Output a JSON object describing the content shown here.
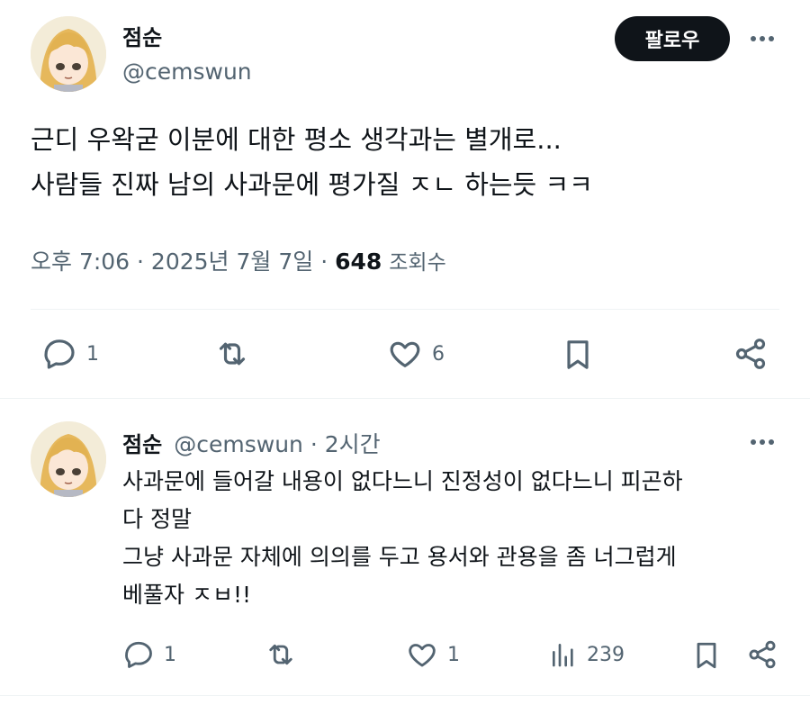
{
  "main_tweet": {
    "author_name": "점순",
    "author_handle": "@cemswun",
    "follow_label": "팔로우",
    "text_line1": "근디 우왁굳 이분에 대한 평소 생각과는 별개로...",
    "text_line2": "사람들 진짜 남의 사과문에 평가질 ㅈㄴ 하는듯 ㅋㅋ",
    "timestamp": "오후 7:06 · 2025년 7월 7일 ·",
    "views_count": "648",
    "views_label": "조회수",
    "reply_count": "1",
    "like_count": "6"
  },
  "reply_tweet": {
    "author_name": "점순",
    "author_handle_time": "@cemswun · 2시간",
    "text_line1": "사과문에 들어갈 내용이 없다느니 진정성이 없다느니 피곤하",
    "text_line2": "다 정말",
    "text_line3": "그냥 사과문 자체에 의의를 두고 용서와 관용을 좀 너그럽게",
    "text_line4": "베풀자 ㅈㅂ!!",
    "reply_count": "1",
    "like_count": "1",
    "view_count": "239"
  },
  "colors": {
    "text_primary": "#0f1419",
    "text_secondary": "#536471",
    "divider": "#eff3f4",
    "follow_bg": "#0f1419"
  },
  "icons": [
    "reply-icon",
    "retweet-icon",
    "like-icon",
    "bookmark-icon",
    "share-icon",
    "views-icon",
    "more-icon"
  ]
}
